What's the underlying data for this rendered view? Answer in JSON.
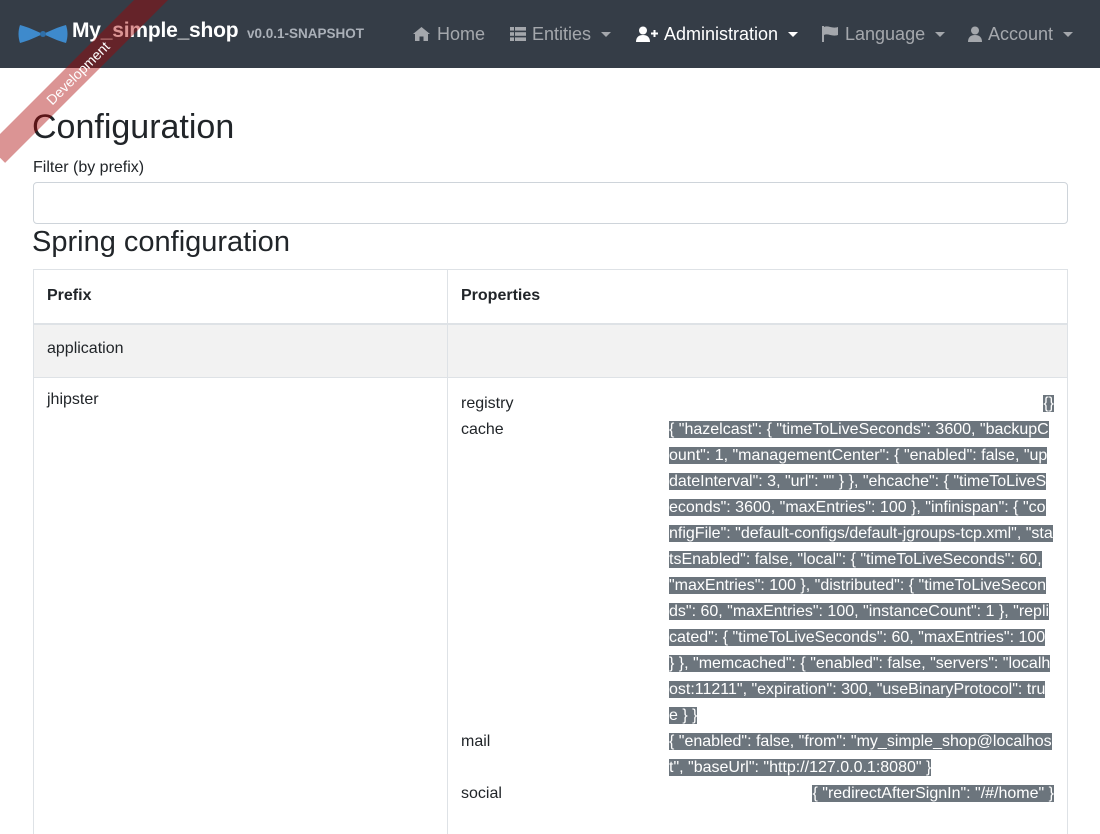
{
  "navbar": {
    "brand_name": "My_simple_shop",
    "version": "v0.0.1-SNAPSHOT",
    "items": [
      {
        "label": "Home",
        "icon": "home-icon"
      },
      {
        "label": "Entities",
        "icon": "table-icon"
      },
      {
        "label": "Administration",
        "icon": "user-plus-icon"
      },
      {
        "label": "Language",
        "icon": "flag-icon"
      },
      {
        "label": "Account",
        "icon": "user-icon"
      }
    ]
  },
  "ribbon": "Development",
  "page": {
    "title": "Configuration",
    "filter_label": "Filter (by prefix)",
    "filter_value": "",
    "section_title": "Spring configuration"
  },
  "table": {
    "headers": [
      "Prefix",
      "Properties"
    ],
    "rows": [
      {
        "prefix": "application",
        "props": []
      },
      {
        "prefix": "jhipster",
        "props": [
          {
            "key": "registry",
            "value": "{}"
          },
          {
            "key": "cache",
            "value": "{ \"hazelcast\": { \"timeToLiveSeconds\": 3600, \"backupCount\": 1, \"managementCenter\": { \"enabled\": false, \"updateInterval\": 3, \"url\": \"\" } }, \"ehcache\": { \"timeToLiveSeconds\": 3600, \"maxEntries\": 100 }, \"infinispan\": { \"configFile\": \"default-configs/default-jgroups-tcp.xml\", \"statsEnabled\": false, \"local\": { \"timeToLiveSeconds\": 60, \"maxEntries\": 100 }, \"distributed\": { \"timeToLiveSeconds\": 60, \"maxEntries\": 100, \"instanceCount\": 1 }, \"replicated\": { \"timeToLiveSeconds\": 60, \"maxEntries\": 100 } }, \"memcached\": { \"enabled\": false, \"servers\": \"localhost:11211\", \"expiration\": 300, \"useBinaryProtocol\": true } }"
          },
          {
            "key": "mail",
            "value": "{ \"enabled\": false, \"from\": \"my_simple_shop@localhost\", \"baseUrl\": \"http://127.0.0.1:8080\" }"
          },
          {
            "key": "social",
            "value": "{ \"redirectAfterSignIn\": \"/#/home\" }"
          }
        ]
      }
    ]
  },
  "colors": {
    "navbar_bg": "#353d47",
    "selection_bg": "#6c757d",
    "logo": "#3e8acc",
    "ribbon": "rgba(170,0,0,0.42)"
  }
}
